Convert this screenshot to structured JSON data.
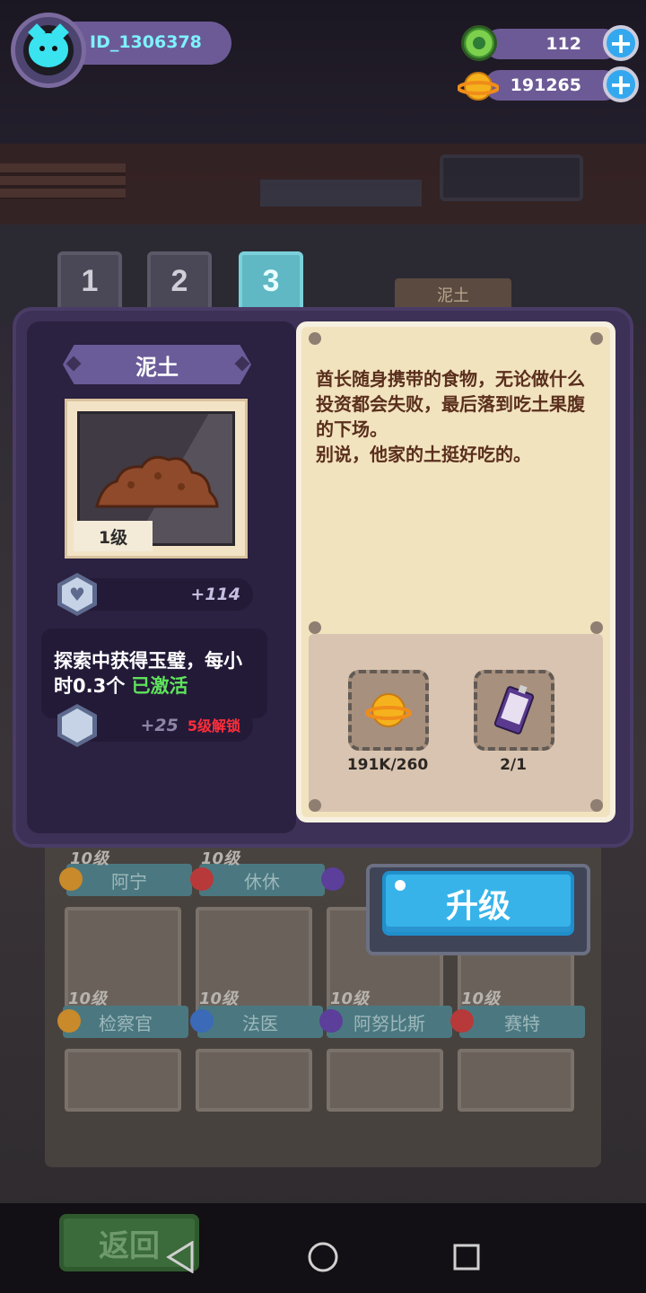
{
  "player": {
    "id": "ID_1306378"
  },
  "currencies": [
    {
      "name": "jade",
      "value": "112",
      "icon": "jade-coin-icon"
    },
    {
      "name": "gold",
      "value": "191265",
      "icon": "gold-planet-coin-icon"
    }
  ],
  "tabs": [
    "1",
    "2",
    "3"
  ],
  "active_tab": "3",
  "item": {
    "name": "泥土",
    "level": "1级",
    "health_bonus": "+114",
    "skill": {
      "text": "探索中获得玉璧，每小时0.3个",
      "status": "已激活"
    },
    "defense_bonus": "+25",
    "unlock_hint": "5级解锁",
    "description": [
      "酋长随身携带的食物，无论做什么投资都会失败，最后落到吃土果腹的下场。",
      "别说，他家的土挺好吃的。"
    ]
  },
  "upgrade_costs": [
    {
      "icon": "gold-planet-coin-icon",
      "amount": "191K/260"
    },
    {
      "icon": "ticket-card-icon",
      "amount": "2/1"
    }
  ],
  "buttons": {
    "upgrade": "升级",
    "back": "返回"
  },
  "background_labels": {
    "item_label": "泥土",
    "row1": [
      {
        "level": "10级",
        "name": "阿宁"
      },
      {
        "level": "10级",
        "name": "休休"
      }
    ],
    "row2": [
      {
        "level": "10级",
        "name": "检察官"
      },
      {
        "level": "10级",
        "name": "法医"
      },
      {
        "level": "10级",
        "name": "阿努比斯"
      },
      {
        "level": "10级",
        "name": "赛特"
      }
    ]
  },
  "colors": {
    "accent_cyan": "#39e3ef",
    "upgrade_blue": "#37b3ea",
    "active_green": "#5ee35b",
    "unlock_red": "#ff2e3a",
    "dialog_purple": "#3d3157"
  }
}
